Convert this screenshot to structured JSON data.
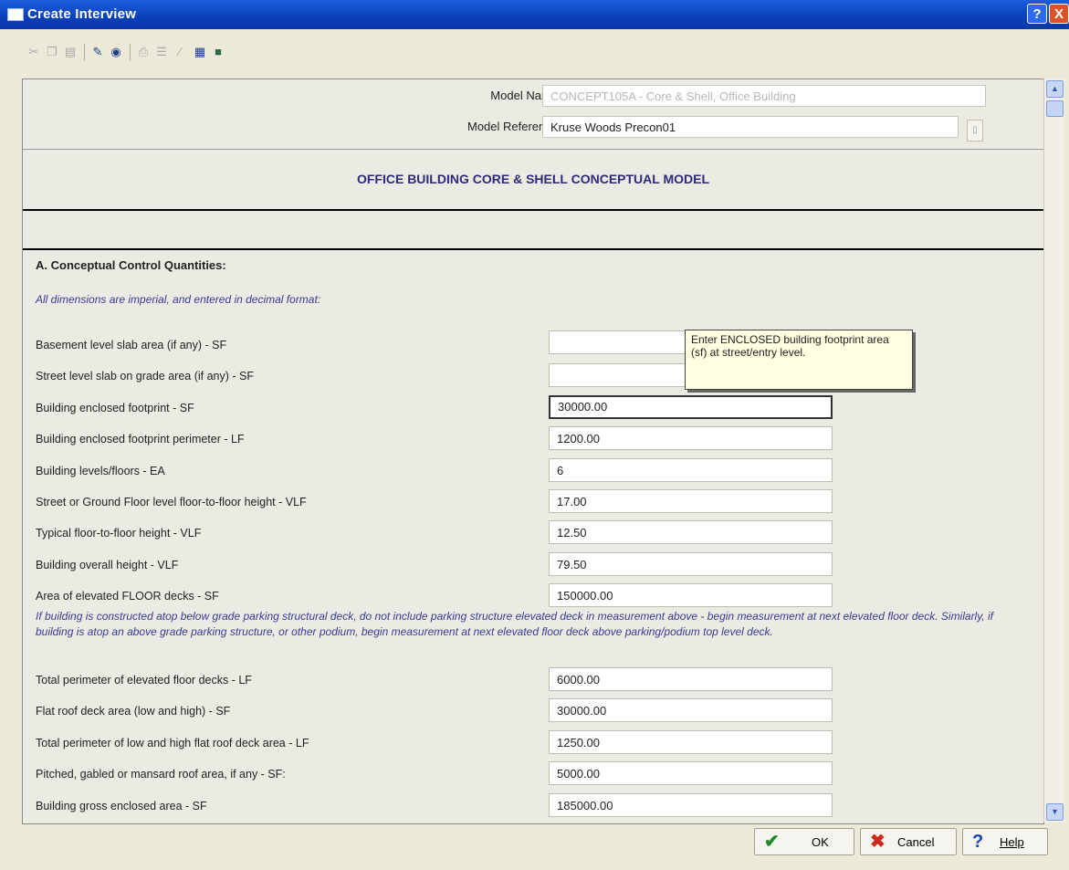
{
  "window": {
    "title": "Create Interview",
    "help_glyph": "?",
    "close_glyph": "X"
  },
  "header": {
    "model_name_label": "Model Name",
    "model_name_value": "CONCEPT105A - Core & Shell, Office Building",
    "model_reference_label": "Model Reference",
    "model_reference_value": "Kruse Woods Precon01"
  },
  "heading": "OFFICE BUILDING CORE & SHELL CONCEPTUAL MODEL",
  "section": {
    "title": "A. Conceptual Control Quantities:",
    "note": "All dimensions are imperial, and entered in decimal format:",
    "note2": "If building is constructed atop below grade parking structural deck, do not include parking structure elevated deck in measurement above - begin measurement at next elevated floor deck. Similarly, if building is atop an above grade parking structure, or other podium, begin measurement at next elevated floor deck above parking/podium top level deck."
  },
  "rows": [
    {
      "label": "Basement level slab area (if any) - SF",
      "value": ""
    },
    {
      "label": "Street level slab on grade area (if any) - SF",
      "value": ""
    },
    {
      "label": "Building enclosed footprint - SF",
      "value": "30000.00"
    },
    {
      "label": "Building enclosed footprint perimeter - LF",
      "value": "1200.00"
    },
    {
      "label": "Building levels/floors - EA",
      "value": "6"
    },
    {
      "label": "Street or Ground Floor level floor-to-floor height - VLF",
      "value": "17.00"
    },
    {
      "label": "Typical floor-to-floor height - VLF",
      "value": "12.50"
    },
    {
      "label": "Building overall height - VLF",
      "value": "79.50"
    },
    {
      "label": "Area of elevated FLOOR decks - SF",
      "value": "150000.00"
    },
    {
      "label": "Total perimeter of elevated floor decks - LF",
      "value": "6000.00"
    },
    {
      "label": "Flat roof deck area (low and high) - SF",
      "value": "30000.00"
    },
    {
      "label": "Total perimeter of low and high flat roof deck area - LF",
      "value": "1250.00"
    },
    {
      "label": "Pitched, gabled or mansard roof area, if any - SF:",
      "value": "5000.00"
    },
    {
      "label": "Building gross enclosed area - SF",
      "value": "185000.00"
    }
  ],
  "tooltip": "Enter ENCLOSED building footprint area (sf) at street/entry level.",
  "buttons": {
    "ok": "OK",
    "cancel": "Cancel",
    "help": "Help"
  },
  "colors": {
    "titlebar": "#0a3fb8",
    "note_text": "#3a3a98",
    "heading_text": "#2d2a7c",
    "tooltip_bg": "#ffffe1"
  },
  "icons": [
    "cut-icon",
    "copy-icon",
    "paste-icon",
    "edit-icon",
    "view-icon",
    "print-icon",
    "format-icon",
    "pen-icon",
    "tree-icon",
    "save-icon"
  ]
}
